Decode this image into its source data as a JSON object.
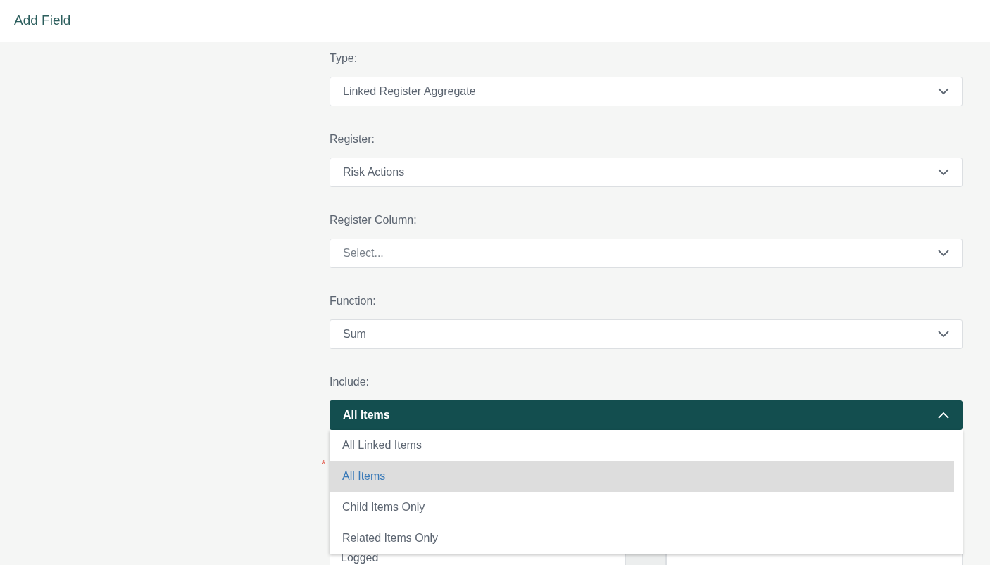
{
  "header": {
    "title": "Add Field"
  },
  "fields": [
    {
      "label": "Type:",
      "value": "Linked Register Aggregate",
      "open": false
    },
    {
      "label": "Register:",
      "value": "Risk Actions",
      "open": false
    },
    {
      "label": "Register Column:",
      "placeholder": "Select...",
      "open": false
    },
    {
      "label": "Function:",
      "value": "Sum",
      "open": false
    },
    {
      "label": "Include:",
      "value": "All Items",
      "open": true,
      "options": [
        {
          "label": "All Linked Items",
          "selected": false
        },
        {
          "label": "All Items",
          "selected": true
        },
        {
          "label": "Child Items Only",
          "selected": false
        },
        {
          "label": "Related Items Only",
          "selected": false
        }
      ]
    }
  ],
  "next_field": {
    "required_marker": "*",
    "value": "Logged"
  }
}
